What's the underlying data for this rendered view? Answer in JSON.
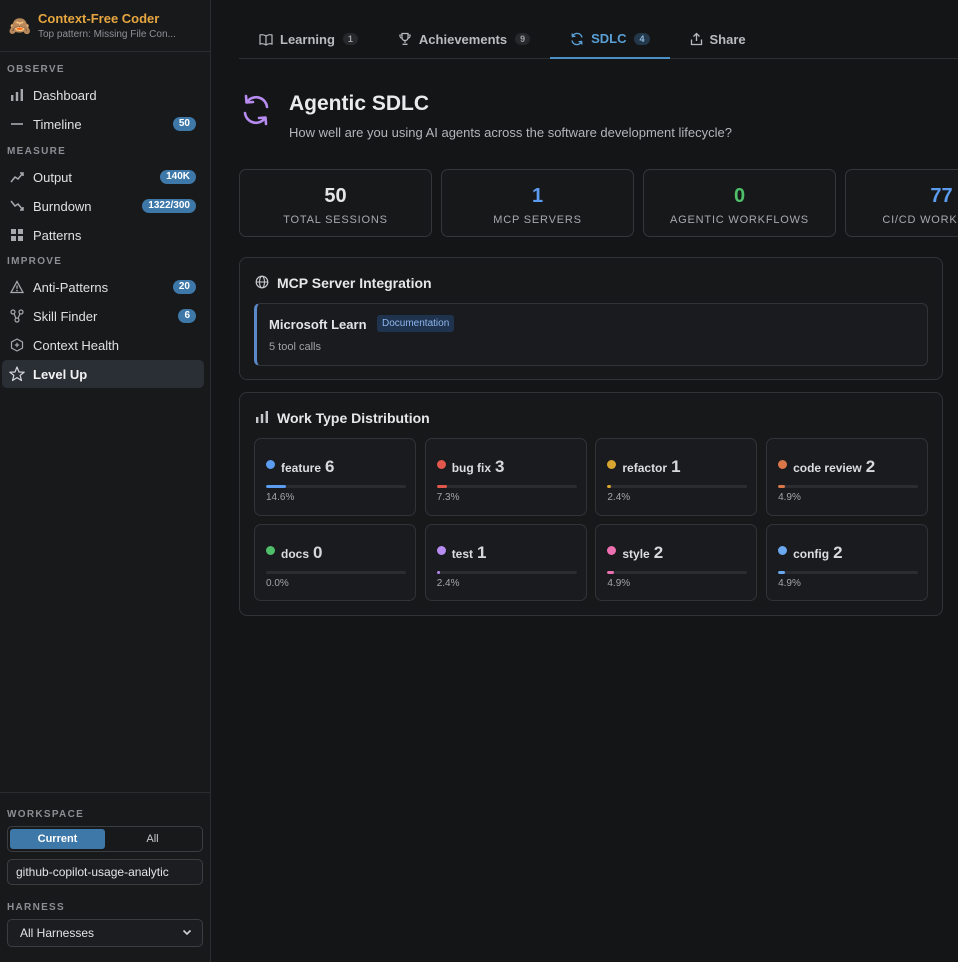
{
  "brand": {
    "emoji": "🙈",
    "title": "Context-Free Coder",
    "subtitle": "Top pattern: Missing File Con..."
  },
  "sidebar": {
    "observe_label": "OBSERVE",
    "measure_label": "MEASURE",
    "improve_label": "IMPROVE",
    "items": [
      {
        "label": "Dashboard",
        "icon": "bar-chart-icon"
      },
      {
        "label": "Timeline",
        "icon": "timeline-icon",
        "badge": "50"
      },
      {
        "label": "Output",
        "icon": "trending-up-icon",
        "badge": "140K"
      },
      {
        "label": "Burndown",
        "icon": "trending-down-icon",
        "badge": "1322/300"
      },
      {
        "label": "Patterns",
        "icon": "grid-icon"
      },
      {
        "label": "Anti-Patterns",
        "icon": "warning-icon",
        "badge": "20"
      },
      {
        "label": "Skill Finder",
        "icon": "network-icon",
        "badge": "6"
      },
      {
        "label": "Context Health",
        "icon": "health-icon"
      },
      {
        "label": "Level Up",
        "icon": "star-icon"
      }
    ],
    "workspace_label": "WORKSPACE",
    "workspace_current": "Current",
    "workspace_all": "All",
    "workspace_value": "github-copilot-usage-analytic",
    "harness_label": "HARNESS",
    "harness_value": "All Harnesses"
  },
  "tabs": [
    {
      "label": "Learning",
      "count": "1",
      "icon": "book-icon"
    },
    {
      "label": "Achievements",
      "count": "9",
      "icon": "trophy-icon"
    },
    {
      "label": "SDLC",
      "count": "4",
      "icon": "refresh-icon"
    },
    {
      "label": "Share",
      "icon": "share-icon"
    }
  ],
  "hero": {
    "title": "Agentic SDLC",
    "subtitle": "How well are you using AI agents across the software development lifecycle?"
  },
  "stats": [
    {
      "value": "50",
      "label": "TOTAL SESSIONS",
      "color": "#e4e5e7"
    },
    {
      "value": "1",
      "label": "MCP SERVERS",
      "color": "#5b9cf0"
    },
    {
      "value": "0",
      "label": "AGENTIC WORKFLOWS",
      "color": "#4fbf6a"
    },
    {
      "value": "77",
      "label": "CI/CD WORKFLOWS",
      "color": "#5b9cf0"
    }
  ],
  "mcp": {
    "title": "MCP Server Integration",
    "server_name": "Microsoft Learn",
    "server_tag": "Documentation",
    "server_calls": "5 tool calls"
  },
  "work": {
    "title": "Work Type Distribution",
    "types": [
      {
        "name": "feature",
        "count": "6",
        "pct": "14.6%",
        "fraction": 0.146,
        "color": "#5b9cf0"
      },
      {
        "name": "bug fix",
        "count": "3",
        "pct": "7.3%",
        "fraction": 0.073,
        "color": "#e2574c"
      },
      {
        "name": "refactor",
        "count": "1",
        "pct": "2.4%",
        "fraction": 0.024,
        "color": "#d9a531"
      },
      {
        "name": "code review",
        "count": "2",
        "pct": "4.9%",
        "fraction": 0.049,
        "color": "#d9774a"
      },
      {
        "name": "docs",
        "count": "0",
        "pct": "0.0%",
        "fraction": 0.0,
        "color": "#4fbf6a"
      },
      {
        "name": "test",
        "count": "1",
        "pct": "2.4%",
        "fraction": 0.024,
        "color": "#b68cf0"
      },
      {
        "name": "style",
        "count": "2",
        "pct": "4.9%",
        "fraction": 0.049,
        "color": "#ec6fb0"
      },
      {
        "name": "config",
        "count": "2",
        "pct": "4.9%",
        "fraction": 0.049,
        "color": "#6aa8f0"
      }
    ]
  }
}
